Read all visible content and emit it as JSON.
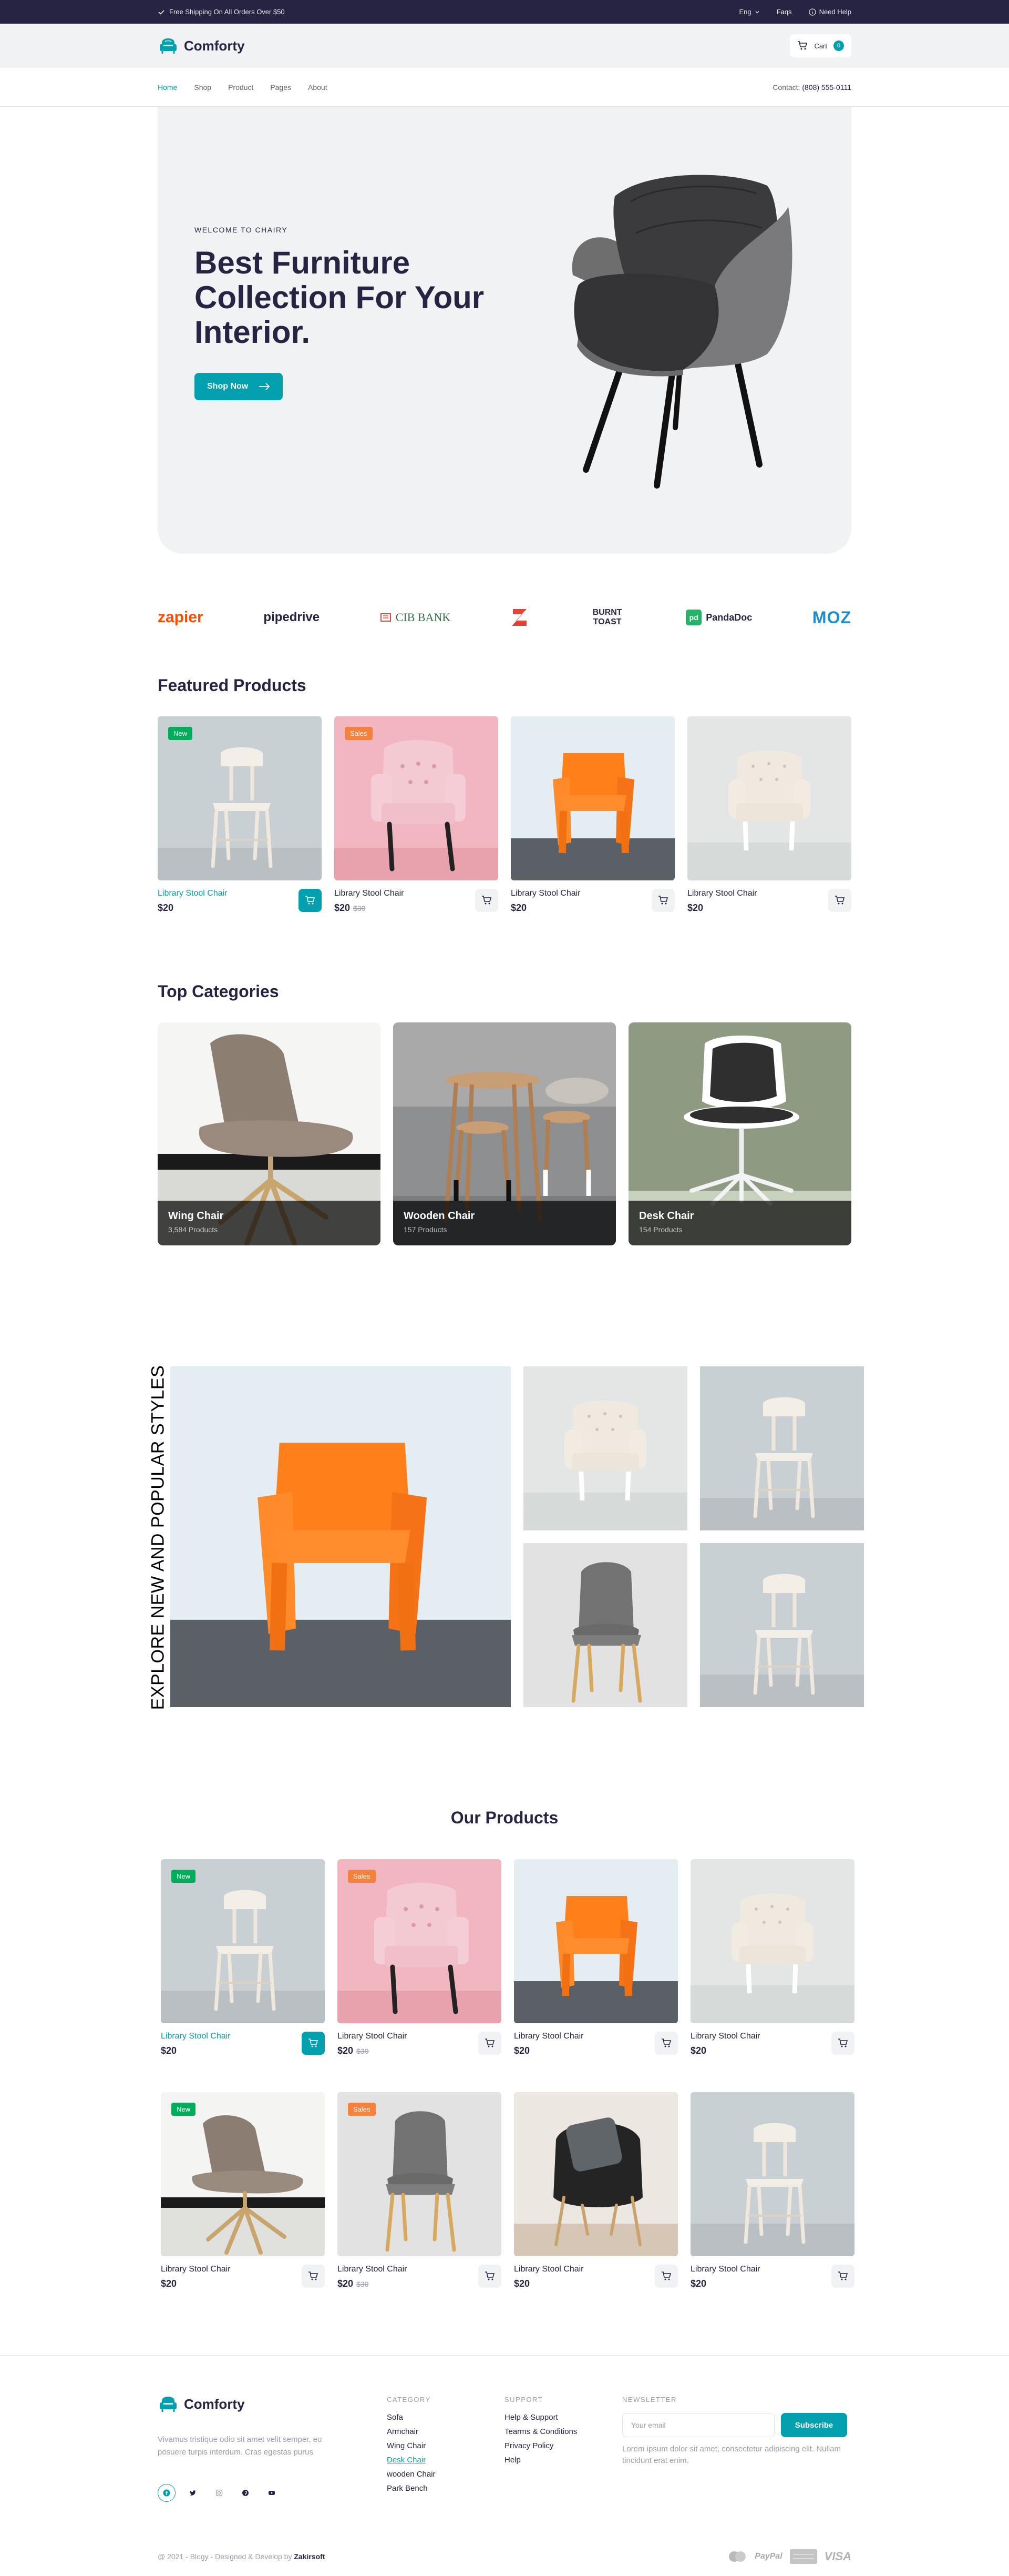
{
  "topbar": {
    "shipping_text": "Free Shipping On All Orders Over $50",
    "language": "Eng",
    "faqs": "Faqs",
    "need_help": "Need Help"
  },
  "header": {
    "brand": "Comforty",
    "cart_label": "Cart",
    "cart_count": "0"
  },
  "nav": {
    "items": [
      {
        "label": "Home",
        "active": true
      },
      {
        "label": "Shop",
        "active": false
      },
      {
        "label": "Product",
        "active": false
      },
      {
        "label": "Pages",
        "active": false
      },
      {
        "label": "About",
        "active": false
      }
    ],
    "contact_label": "Contact:",
    "contact_phone": "(808) 555-0111"
  },
  "hero": {
    "eyebrow": "WELCOME TO CHAIRY",
    "title": "Best Furniture Collection For Your Interior.",
    "button": "Shop Now"
  },
  "brands": [
    "zapier",
    "pipedrive",
    "CIB BANK",
    "Z",
    "BURNT TOAST",
    "PandaDoc",
    "MOZ"
  ],
  "featured": {
    "title": "Featured Products",
    "products": [
      {
        "name": "Library Stool Chair",
        "price": "$20",
        "old_price": "",
        "badge": "New",
        "image": "white-wood-chair",
        "highlight": true
      },
      {
        "name": "Library Stool Chair",
        "price": "$20",
        "old_price": "$30",
        "badge": "Sales",
        "image": "pink-armchair",
        "highlight": false
      },
      {
        "name": "Library Stool Chair",
        "price": "$20",
        "old_price": "",
        "badge": "",
        "image": "orange-chair",
        "highlight": false
      },
      {
        "name": "Library Stool Chair",
        "price": "$20",
        "old_price": "",
        "badge": "",
        "image": "white-tufted-chair",
        "highlight": false
      }
    ]
  },
  "categories": {
    "title": "Top Categories",
    "items": [
      {
        "name": "Wing Chair",
        "count": "3,584 Products"
      },
      {
        "name": "Wooden Chair",
        "count": "157 Products"
      },
      {
        "name": "Desk Chair",
        "count": "154 Products"
      }
    ]
  },
  "explore": {
    "label": "EXPLORE NEW AND POPULAR STYLES"
  },
  "our_products": {
    "title": "Our Products",
    "products": [
      {
        "name": "Library Stool Chair",
        "price": "$20",
        "old_price": "",
        "badge": "New",
        "image": "white-wood-chair",
        "highlight": true
      },
      {
        "name": "Library Stool Chair",
        "price": "$20",
        "old_price": "$30",
        "badge": "Sales",
        "image": "pink-armchair",
        "highlight": false
      },
      {
        "name": "Library Stool Chair",
        "price": "$20",
        "old_price": "",
        "badge": "",
        "image": "orange-chair",
        "highlight": false
      },
      {
        "name": "Library Stool Chair",
        "price": "$20",
        "old_price": "",
        "badge": "",
        "image": "white-tufted-chair",
        "highlight": false
      },
      {
        "name": "Library Stool Chair",
        "price": "$20",
        "old_price": "",
        "badge": "New",
        "image": "wing-chair",
        "highlight": false
      },
      {
        "name": "Library Stool Chair",
        "price": "$20",
        "old_price": "$30",
        "badge": "Sales",
        "image": "grey-wood-chair",
        "highlight": false
      },
      {
        "name": "Library Stool Chair",
        "price": "$20",
        "old_price": "",
        "badge": "",
        "image": "black-pillow-chair",
        "highlight": false
      },
      {
        "name": "Library Stool Chair",
        "price": "$20",
        "old_price": "",
        "badge": "",
        "image": "white-wood-chair",
        "highlight": false
      }
    ]
  },
  "footer": {
    "brand": "Comforty",
    "description": "Vivamus tristique odio sit amet velit semper, eu posuere turpis interdum. Cras egestas purus",
    "category_heading": "CATEGORY",
    "category_links": [
      "Sofa",
      "Armchair",
      "Wing Chair",
      "Desk Chair",
      "wooden Chair",
      "Park Bench"
    ],
    "support_heading": "SUPPORT",
    "support_links": [
      "Help & Support",
      "Tearms & Conditions",
      "Privacy Policy",
      "Help"
    ],
    "newsletter_heading": "NEWSLETTER",
    "email_placeholder": "Your email",
    "subscribe": "Subscribe",
    "newsletter_note": "Lorem ipsum dolor sit amet, consectetur adipiscing elit. Nullam tincidunt erat enim.",
    "copyright": "@ 2021 - Blogy - Designed & Develop by",
    "copyright_brand": "Zakirsoft",
    "payments": [
      "PayPal",
      "VISA"
    ]
  },
  "colors": {
    "accent": "#029fae",
    "navy": "#272343",
    "new_badge": "#01ad5a",
    "sale_badge": "#f5813f"
  }
}
